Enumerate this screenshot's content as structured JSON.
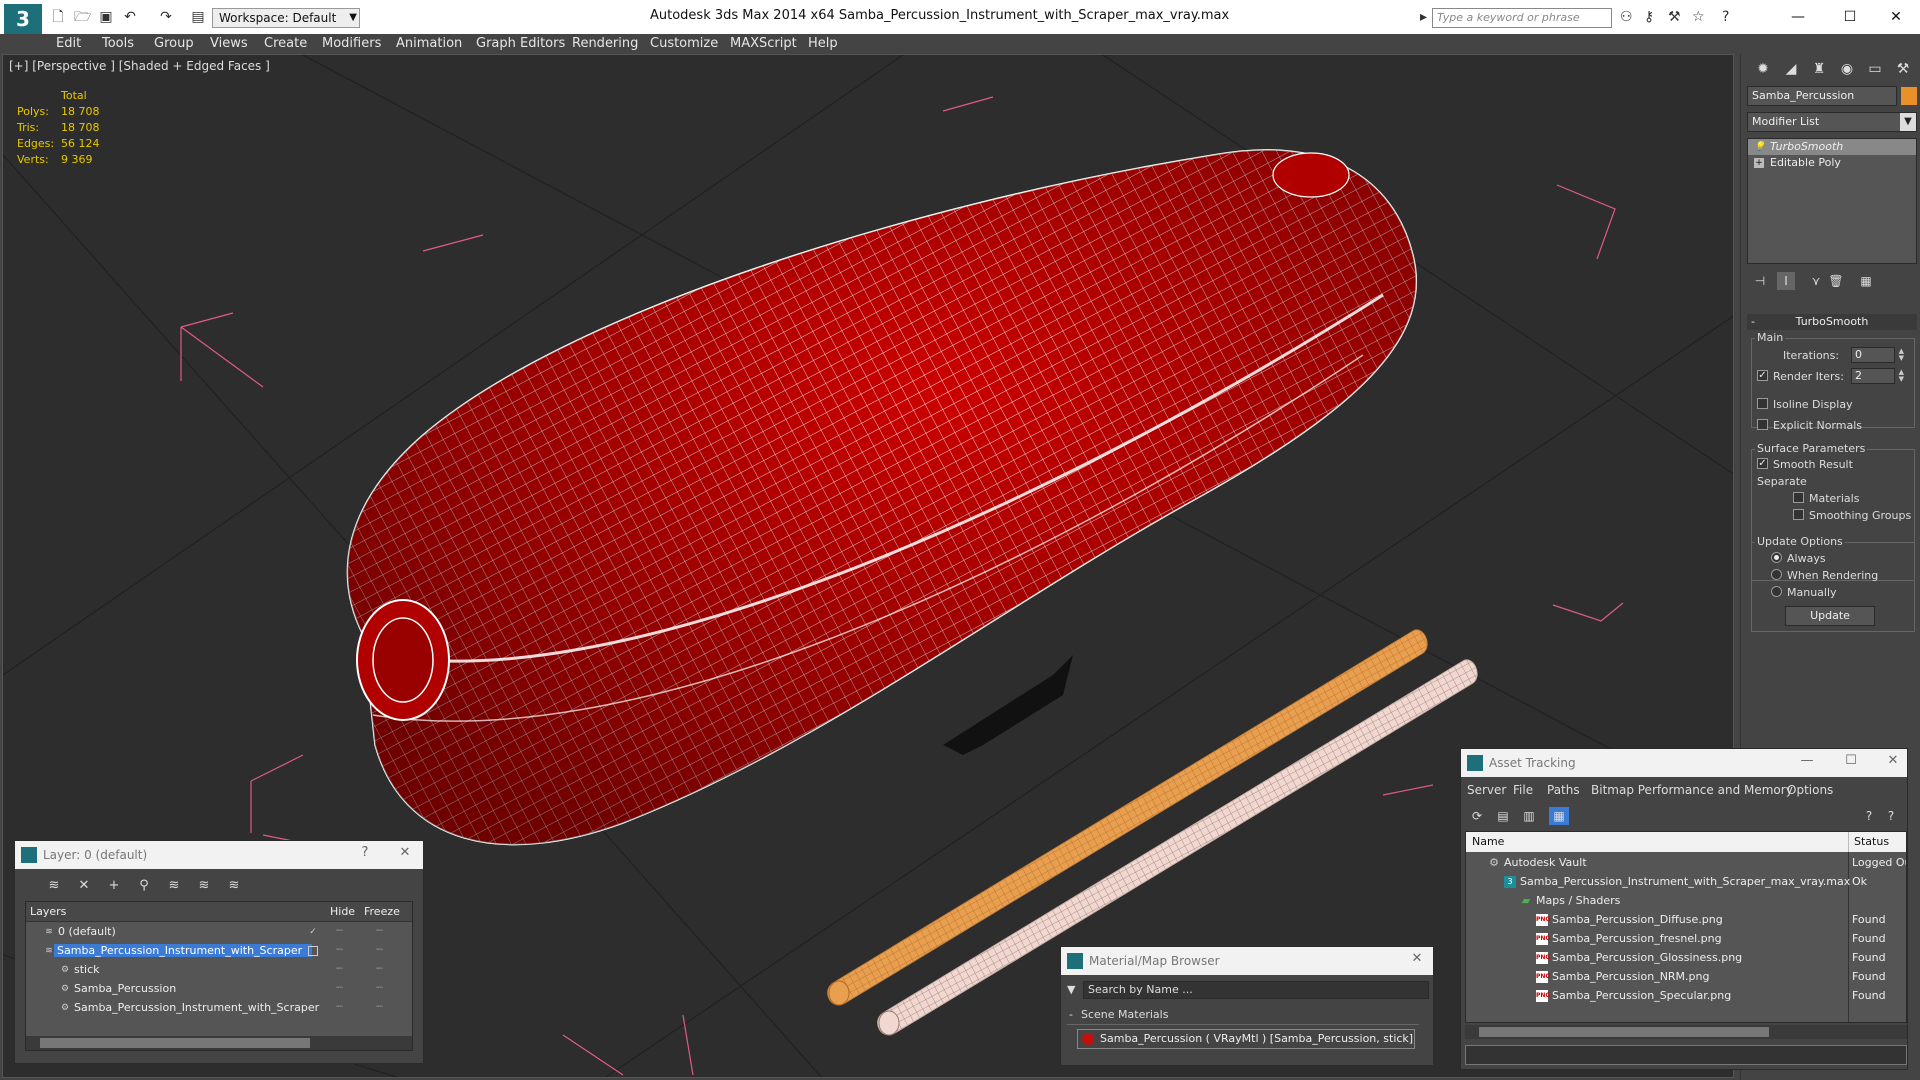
{
  "titlebar": {
    "workspace": "Workspace: Default",
    "app_title": "Autodesk 3ds Max  2014 x64     Samba_Percussion_Instrument_with_Scraper_max_vray.max",
    "search_placeholder": "Type a keyword or phrase"
  },
  "menu": [
    "Edit",
    "Tools",
    "Group",
    "Views",
    "Create",
    "Modifiers",
    "Animation",
    "Graph Editors",
    "Rendering",
    "Customize",
    "MAXScript",
    "Help"
  ],
  "viewport": {
    "label": "[+] [Perspective ] [Shaded + Edged Faces ]",
    "stats_header": "Total",
    "stats": [
      {
        "key": "Polys:",
        "value": "18 708"
      },
      {
        "key": "Tris:",
        "value": "18 708"
      },
      {
        "key": "Edges:",
        "value": "56 124"
      },
      {
        "key": "Verts:",
        "value": "9 369"
      }
    ],
    "colors": {
      "body": "#cc0000",
      "wire": "#ffffff",
      "stick1": "#e8a050",
      "stick2": "#f0d8d0",
      "bbox": "#e05a8a"
    }
  },
  "command_panel": {
    "object_name": "Samba_Percussion",
    "object_color": "#e8902a",
    "modifier_list": "Modifier List",
    "stack": [
      "TurboSmooth",
      "Editable Poly"
    ],
    "rollout_title": "TurboSmooth",
    "main_group": "Main",
    "iterations_label": "Iterations:",
    "iterations_value": "0",
    "render_iters_label": "Render Iters:",
    "render_iters_value": "2",
    "isoline_display": "Isoline Display",
    "explicit_normals": "Explicit Normals",
    "surface_params": "Surface Parameters",
    "smooth_result": "Smooth Result",
    "separate": "Separate",
    "materials": "Materials",
    "smoothing_groups": "Smoothing Groups",
    "update_options": "Update Options",
    "always": "Always",
    "when_rendering": "When Rendering",
    "manually": "Manually",
    "update_button": "Update"
  },
  "layer_window": {
    "title": "Layer: 0 (default)",
    "help": "?",
    "close": "✕",
    "col_layers": "Layers",
    "col_hide": "Hide",
    "col_freeze": "Freeze",
    "rows": [
      {
        "name": "0 (default)"
      },
      {
        "name": "Samba_Percussion_Instrument_with_Scraper"
      },
      {
        "name": "stick"
      },
      {
        "name": "Samba_Percussion"
      },
      {
        "name": "Samba_Percussion_Instrument_with_Scraper"
      }
    ]
  },
  "material_browser": {
    "title": "Material/Map Browser",
    "search_placeholder": "Search by Name ...",
    "group": "Scene Materials",
    "item": "Samba_Percussion  ( VRayMtl )  [Samba_Percussion, stick]"
  },
  "asset_tracking": {
    "title": "Asset Tracking",
    "menu": [
      "Server",
      "File",
      "Paths",
      "Bitmap Performance and Memory",
      "Options"
    ],
    "col_name": "Name",
    "col_status": "Status",
    "rows": [
      {
        "name": "Autodesk Vault",
        "status": "Logged Ou"
      },
      {
        "name": "Samba_Percussion_Instrument_with_Scraper_max_vray.max",
        "status": "Ok"
      },
      {
        "name": "Maps / Shaders",
        "status": ""
      },
      {
        "name": "Samba_Percussion_Diffuse.png",
        "status": "Found"
      },
      {
        "name": "Samba_Percussion_fresnel.png",
        "status": "Found"
      },
      {
        "name": "Samba_Percussion_Glossiness.png",
        "status": "Found"
      },
      {
        "name": "Samba_Percussion_NRM.png",
        "status": "Found"
      },
      {
        "name": "Samba_Percussion_Specular.png",
        "status": "Found"
      }
    ]
  }
}
